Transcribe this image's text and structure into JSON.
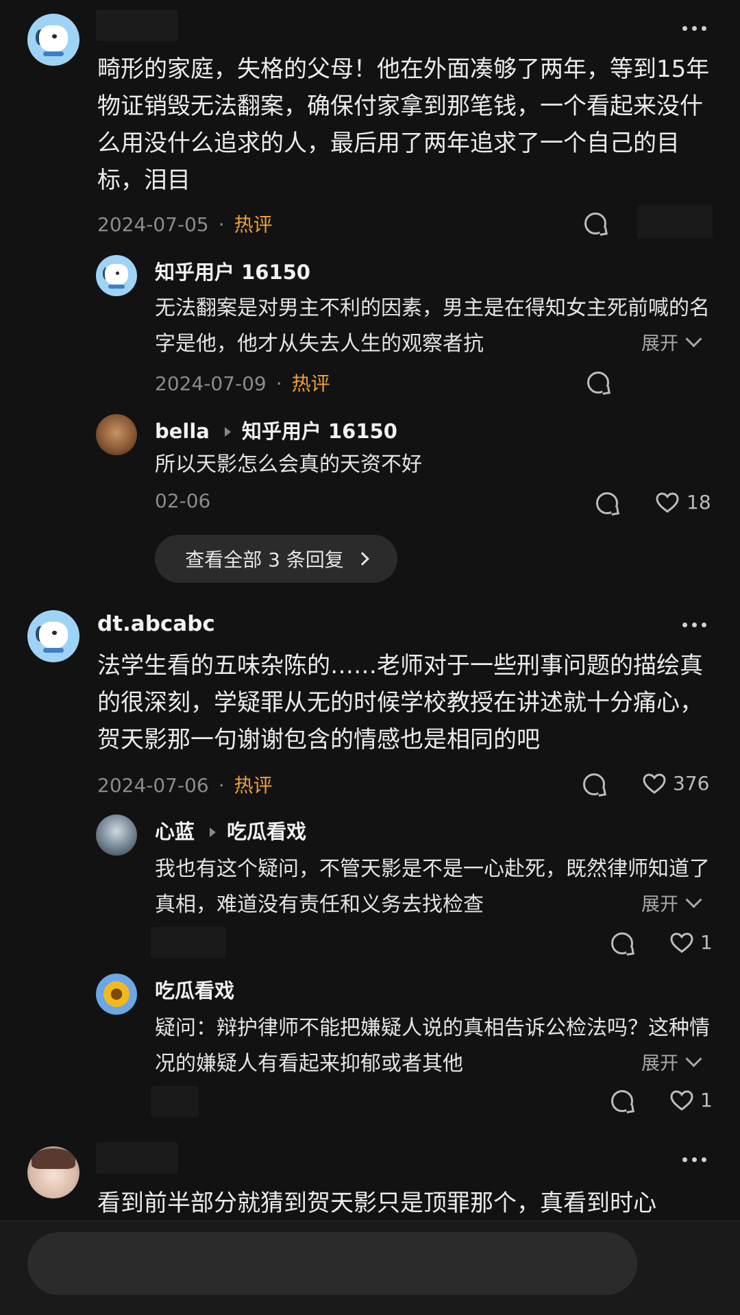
{
  "comments": [
    {
      "username": "",
      "text": "畸形的家庭，失格的父母！他在外面凑够了两年，等到15年物证销毁无法翻案，确保付家拿到那笔钱，一个看起来没什么用没什么追求的人，最后用了两年追求了一个自己的目标，泪目",
      "date": "2024-07-05",
      "badge": "热评",
      "avatar_icon": "dog-avatar",
      "replies": [
        {
          "username": "知乎用户 16150",
          "reply_to": "",
          "text": "无法翻案是对男主不利的因素，男主是在得知女主死前喊的名字是他，他才从失去人生的观察者抗",
          "expand": "展开",
          "date": "2024-07-09",
          "badge": "热评",
          "likes": ""
        },
        {
          "username": "bella",
          "reply_to": "知乎用户 16150",
          "text": "所以天影怎么会真的天资不好",
          "date": "02-06",
          "badge": "",
          "likes": "18"
        }
      ],
      "view_all": "查看全部 3 条回复"
    },
    {
      "username": "dt.abcabc",
      "text": "法学生看的五味杂陈的……老师对于一些刑事问题的描绘真的很深刻，学疑罪从无的时候学校教授在讲述就十分痛心，贺天影那一句谢谢包含的情感也是相同的吧",
      "date": "2024-07-06",
      "badge": "热评",
      "likes": "376",
      "replies": [
        {
          "username": "心蓝",
          "reply_to": "吃瓜看戏",
          "text": "我也有这个疑问，不管天影是不是一心赴死，既然律师知道了真相，难道没有责任和义务去找检查",
          "expand": "展开",
          "likes": "1"
        },
        {
          "username": "吃瓜看戏",
          "reply_to": "",
          "text": "疑问：辩护律师不能把嫌疑人说的真相告诉公检法吗？这种情况的嫌疑人有看起来抑郁或者其他",
          "expand": "展开",
          "likes": "1"
        }
      ]
    },
    {
      "username": "",
      "text": "看到前半部分就猜到贺天影只是顶罪那个，真看到时心"
    }
  ],
  "colors": {
    "background": "#121212",
    "hot_badge": "#f0a036",
    "muted": "#8c8c8c"
  },
  "icons": [
    "more-icon",
    "comment-icon",
    "heart-icon",
    "chevron-down-icon",
    "chevron-right-icon"
  ]
}
